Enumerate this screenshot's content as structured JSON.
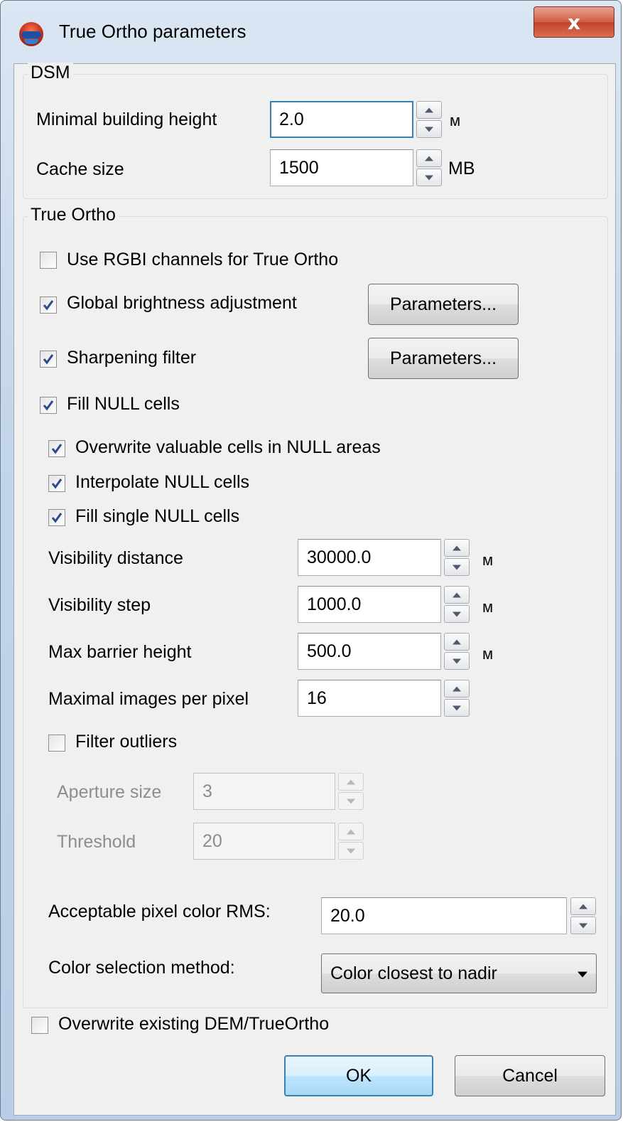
{
  "window": {
    "title": "True Ortho parameters",
    "close_label": "x"
  },
  "dsm": {
    "group_title": "DSM",
    "min_building_height": {
      "label": "Minimal building height",
      "value": "2.0",
      "unit": "м"
    },
    "cache_size": {
      "label": "Cache size",
      "value": "1500",
      "unit": "MB"
    }
  },
  "true_ortho": {
    "group_title": "True Ortho",
    "use_rgbi": {
      "label": "Use RGBI channels for True Ortho",
      "checked": false
    },
    "global_brightness": {
      "label": "Global brightness adjustment",
      "checked": true,
      "button_label": "Parameters..."
    },
    "sharpening_filter": {
      "label": "Sharpening filter",
      "checked": true,
      "button_label": "Parameters..."
    },
    "fill_null": {
      "label": "Fill NULL cells",
      "checked": true
    },
    "overwrite_valuable": {
      "label": "Overwrite valuable cells in NULL areas",
      "checked": true
    },
    "interpolate_null": {
      "label": "Interpolate NULL cells",
      "checked": true
    },
    "fill_single_null": {
      "label": "Fill single NULL cells",
      "checked": true
    },
    "visibility_distance": {
      "label": "Visibility distance",
      "value": "30000.0",
      "unit": "м"
    },
    "visibility_step": {
      "label": "Visibility step",
      "value": "1000.0",
      "unit": "м"
    },
    "max_barrier_height": {
      "label": "Max barrier height",
      "value": "500.0",
      "unit": "м"
    },
    "max_images_per_pixel": {
      "label": "Maximal images per pixel",
      "value": "16"
    },
    "filter_outliers": {
      "label": "Filter outliers",
      "checked": false
    },
    "aperture_size": {
      "label": "Aperture size",
      "value": "3",
      "disabled": true
    },
    "threshold": {
      "label": "Threshold",
      "value": "20",
      "disabled": true
    },
    "acceptable_rms": {
      "label": "Acceptable pixel color RMS:",
      "value": "20.0"
    },
    "color_selection": {
      "label": "Color selection method:",
      "selected": "Color closest to nadir"
    }
  },
  "overwrite_existing": {
    "label": "Overwrite existing DEM/TrueOrtho",
    "checked": false
  },
  "buttons": {
    "ok": "OK",
    "cancel": "Cancel"
  },
  "colors": {
    "title_bar": "#c3d5ea",
    "client_bg": "#f0f0f0",
    "close_button": "#c0432b",
    "focus_border": "#3c7fb1"
  }
}
